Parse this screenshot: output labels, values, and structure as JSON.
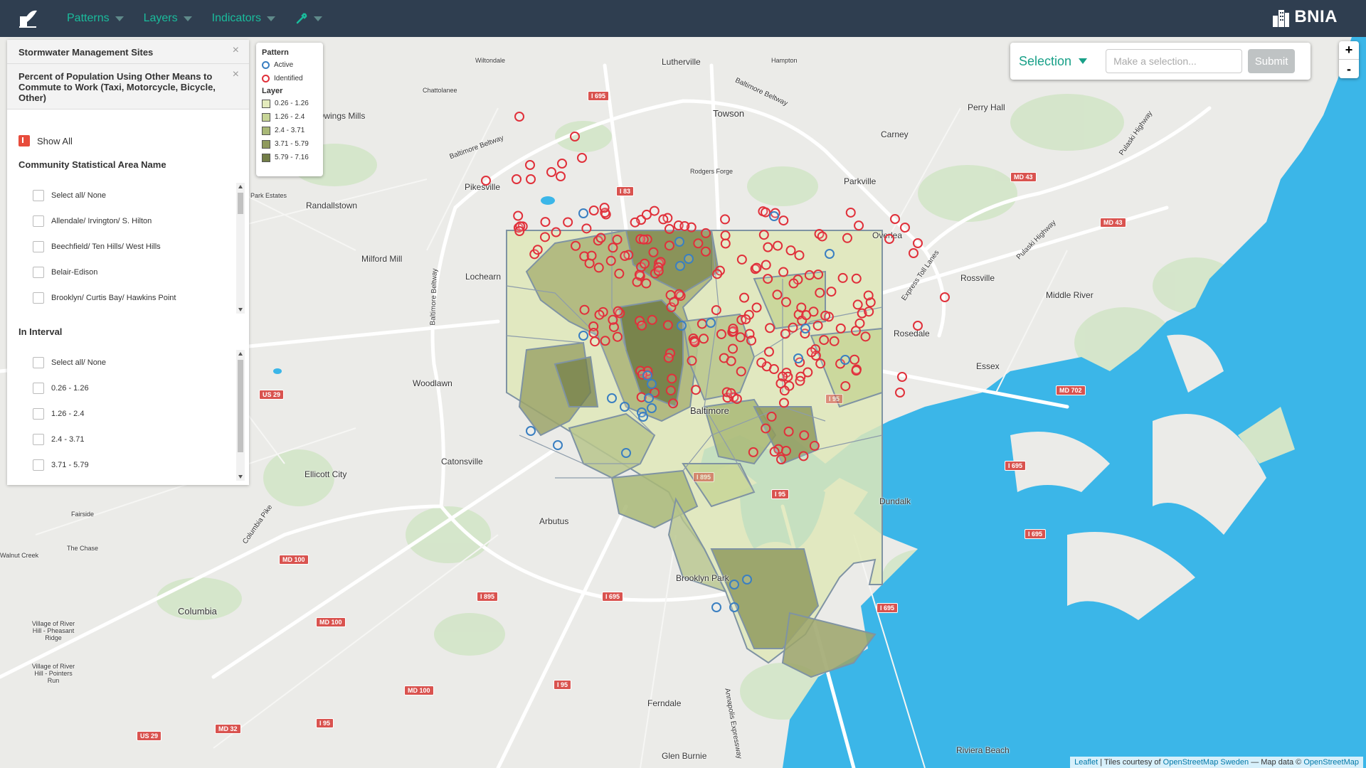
{
  "navbar": {
    "menu": [
      {
        "label": "Patterns"
      },
      {
        "label": "Layers"
      },
      {
        "label": "Indicators"
      }
    ],
    "tools_icon": "wrench-icon",
    "brand": "BNIA"
  },
  "panel": {
    "layers": [
      {
        "title": "Stormwater Management Sites"
      },
      {
        "title": "Percent of Population Using Other Means to Commute to Work (Taxi, Motorcycle, Bicycle, Other)"
      }
    ],
    "show_all": "Show All",
    "csa_title": "Community Statistical Area Name",
    "csa_items": [
      "Select all/ None",
      "Allendale/ Irvington/ S. Hilton",
      "Beechfield/ Ten Hills/ West Hills",
      "Belair-Edison",
      "Brooklyn/ Curtis Bay/ Hawkins Point"
    ],
    "interval_title": "In Interval",
    "interval_items": [
      "Select all/ None",
      "0.26 - 1.26",
      "1.26 - 2.4",
      "2.4 - 3.71",
      "3.71 - 5.79"
    ]
  },
  "legend": {
    "pattern_title": "Pattern",
    "pattern": [
      {
        "label": "Active",
        "color": "#3a7fc1"
      },
      {
        "label": "Identified",
        "color": "#e0303a"
      }
    ],
    "layer_title": "Layer",
    "layer": [
      {
        "label": "0.26 - 1.26",
        "color": "#e4ebbd"
      },
      {
        "label": "1.26 - 2.4",
        "color": "#c7d597"
      },
      {
        "label": "2.4 - 3.71",
        "color": "#a9b877"
      },
      {
        "label": "3.71 - 5.79",
        "color": "#8f9a5e"
      },
      {
        "label": "5.79 - 7.16",
        "color": "#727d47"
      }
    ]
  },
  "selection": {
    "label": "Selection",
    "placeholder": "Make a selection...",
    "submit": "Submit"
  },
  "zoom": {
    "in": "+",
    "out": "-"
  },
  "attribution": {
    "leaflet": "Leaflet",
    "tiles_prefix": " | Tiles courtesy of ",
    "tiles_link": "OpenStreetMap Sweden",
    "data_prefix": " — Map data © ",
    "data_link": "OpenStreetMap"
  },
  "map_labels": {
    "places": [
      "Lutherville",
      "Towson",
      "Perry Hall",
      "Carney",
      "Parkville",
      "Pikesville",
      "Randallstown",
      "Milford Mill",
      "Lochearn",
      "Woodlawn",
      "Catonsville",
      "Ellicott City",
      "Arbutus",
      "Columbia",
      "Brooklyn Park",
      "Ferndale",
      "Glen Burnie",
      "Riviera Beach",
      "Dundalk",
      "Essex",
      "Rosedale",
      "Rossville",
      "Middle River",
      "Overlea",
      "Baltimore",
      "Hampton",
      "Rodgers Forge",
      "Owings Mills",
      "Park Estates",
      "Chattolanee",
      "Wiltondale",
      "Fairside",
      "The Chase",
      "Walnut Creek",
      "Village of River Hill - Pheasant Ridge",
      "Village of River Hill - Pointers Run"
    ],
    "roads": [
      "Baltimore Beltway",
      "Baltimore Beltway",
      "Baltimore Beltway",
      "Columbia Pike",
      "Pulaski Highway",
      "Pulaski Highway",
      "Express Toll Lanes",
      "Annapolis Expressway"
    ],
    "shields": [
      "I 695",
      "I 83",
      "MD 43",
      "MD 43",
      "US 29",
      "MD 100",
      "MD 100",
      "I 895",
      "I 695",
      "I 95",
      "I 95",
      "MD 100",
      "MD 32",
      "US 29",
      "I 95",
      "I 695",
      "I 695",
      "I 695",
      "MD 702",
      "I 895",
      "I 95"
    ]
  }
}
